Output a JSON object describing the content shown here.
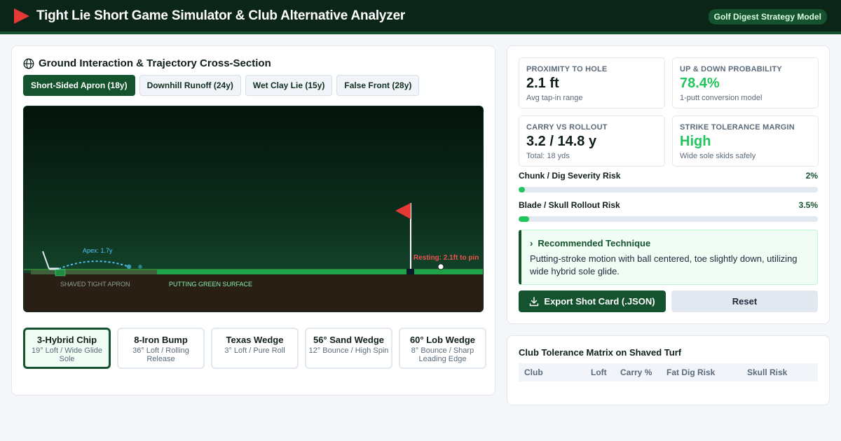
{
  "header": {
    "title": "Tight Lie Short Game Simulator & Club Alternative Analyzer",
    "badge": "Golf Digest Strategy Model"
  },
  "simulator": {
    "title": "Ground Interaction & Trajectory Cross-Section",
    "tabs": [
      {
        "label": "Short-Sided Apron (18y)",
        "active": true
      },
      {
        "label": "Downhill Runoff (24y)",
        "active": false
      },
      {
        "label": "Wet Clay Lie (15y)",
        "active": false
      },
      {
        "label": "False Front (28y)",
        "active": false
      }
    ],
    "canvas": {
      "apex_label": "Apex: 1.7y",
      "resting_label": "Resting: 2.1ft to pin",
      "apron_label": "SHAVED TIGHT APRON",
      "green_label": "PUTTING GREEN SURFACE"
    },
    "clubs": [
      {
        "name": "3-Hybrid Chip",
        "spec": "19° Loft / Wide Glide Sole",
        "active": true
      },
      {
        "name": "8-Iron Bump",
        "spec": "36° Loft / Rolling Release",
        "active": false
      },
      {
        "name": "Texas Wedge",
        "spec": "3° Loft / Pure Roll",
        "active": false
      },
      {
        "name": "56° Sand Wedge",
        "spec": "12° Bounce / High Spin",
        "active": false
      },
      {
        "name": "60° Lob Wedge",
        "spec": "8° Bounce / Sharp Leading Edge",
        "active": false
      }
    ]
  },
  "metrics": [
    {
      "label": "Proximity to Hole",
      "value": "2.1 ft",
      "sub": "Avg tap-in range",
      "highlight": false
    },
    {
      "label": "Up & Down Probability",
      "value": "78.4%",
      "sub": "1-putt conversion model",
      "highlight": true
    },
    {
      "label": "Carry vs Rollout",
      "value": "3.2 / 14.8 y",
      "sub": "Total: 18 yds",
      "highlight": false
    },
    {
      "label": "Strike Tolerance Margin",
      "value": "High",
      "sub": "Wide sole skids safely",
      "highlight": true
    }
  ],
  "risks": [
    {
      "label": "Chunk / Dig Severity Risk",
      "value": "2%",
      "percent": 2
    },
    {
      "label": "Blade / Skull Rollout Risk",
      "value": "3.5%",
      "percent": 3.5
    }
  ],
  "technique": {
    "title": "Recommended Technique",
    "body": "Putting-stroke motion with ball centered, toe slightly down, utilizing wide hybrid sole glide."
  },
  "actions": {
    "export_label": "Export Shot Card (.JSON)",
    "reset_label": "Reset"
  },
  "matrix": {
    "title": "Club Tolerance Matrix on Shaved Turf",
    "columns": [
      "Club",
      "Loft",
      "Carry %",
      "Fat Dig Risk",
      "Skull Risk"
    ]
  },
  "colors": {
    "brand_dark": "#0b2518",
    "brand_green": "#14532d",
    "accent_green": "#22c55e",
    "flag_red": "#e53935",
    "trajectory_blue": "#4fc3f7"
  }
}
